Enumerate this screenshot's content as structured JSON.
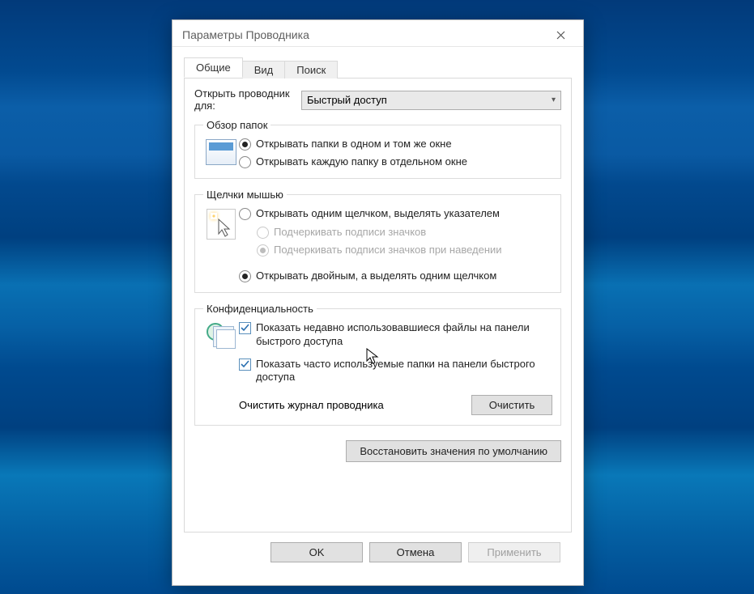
{
  "window": {
    "title": "Параметры Проводника"
  },
  "tabs": {
    "general": "Общие",
    "view": "Вид",
    "search": "Поиск"
  },
  "open_for": {
    "label": "Открыть проводник для:",
    "selected": "Быстрый доступ"
  },
  "browse": {
    "legend": "Обзор папок",
    "same_window": "Открывать папки в одном и том же окне",
    "separate_window": "Открывать каждую папку в отдельном окне"
  },
  "click": {
    "legend": "Щелчки мышью",
    "single_click": "Открывать одним щелчком, выделять указателем",
    "underline_always": "Подчеркивать подписи значков",
    "underline_hover": "Подчеркивать подписи значков при наведении",
    "double_click": "Открывать двойным, а выделять одним щелчком"
  },
  "privacy": {
    "legend": "Конфиденциальность",
    "recent_files": "Показать недавно использовавшиеся файлы на панели быстрого доступа",
    "frequent_folders": "Показать часто используемые папки на панели быстрого доступа",
    "clear_label": "Очистить журнал проводника",
    "clear_button": "Очистить"
  },
  "restore_defaults": "Восстановить значения по умолчанию",
  "buttons": {
    "ok": "OK",
    "cancel": "Отмена",
    "apply": "Применить"
  }
}
